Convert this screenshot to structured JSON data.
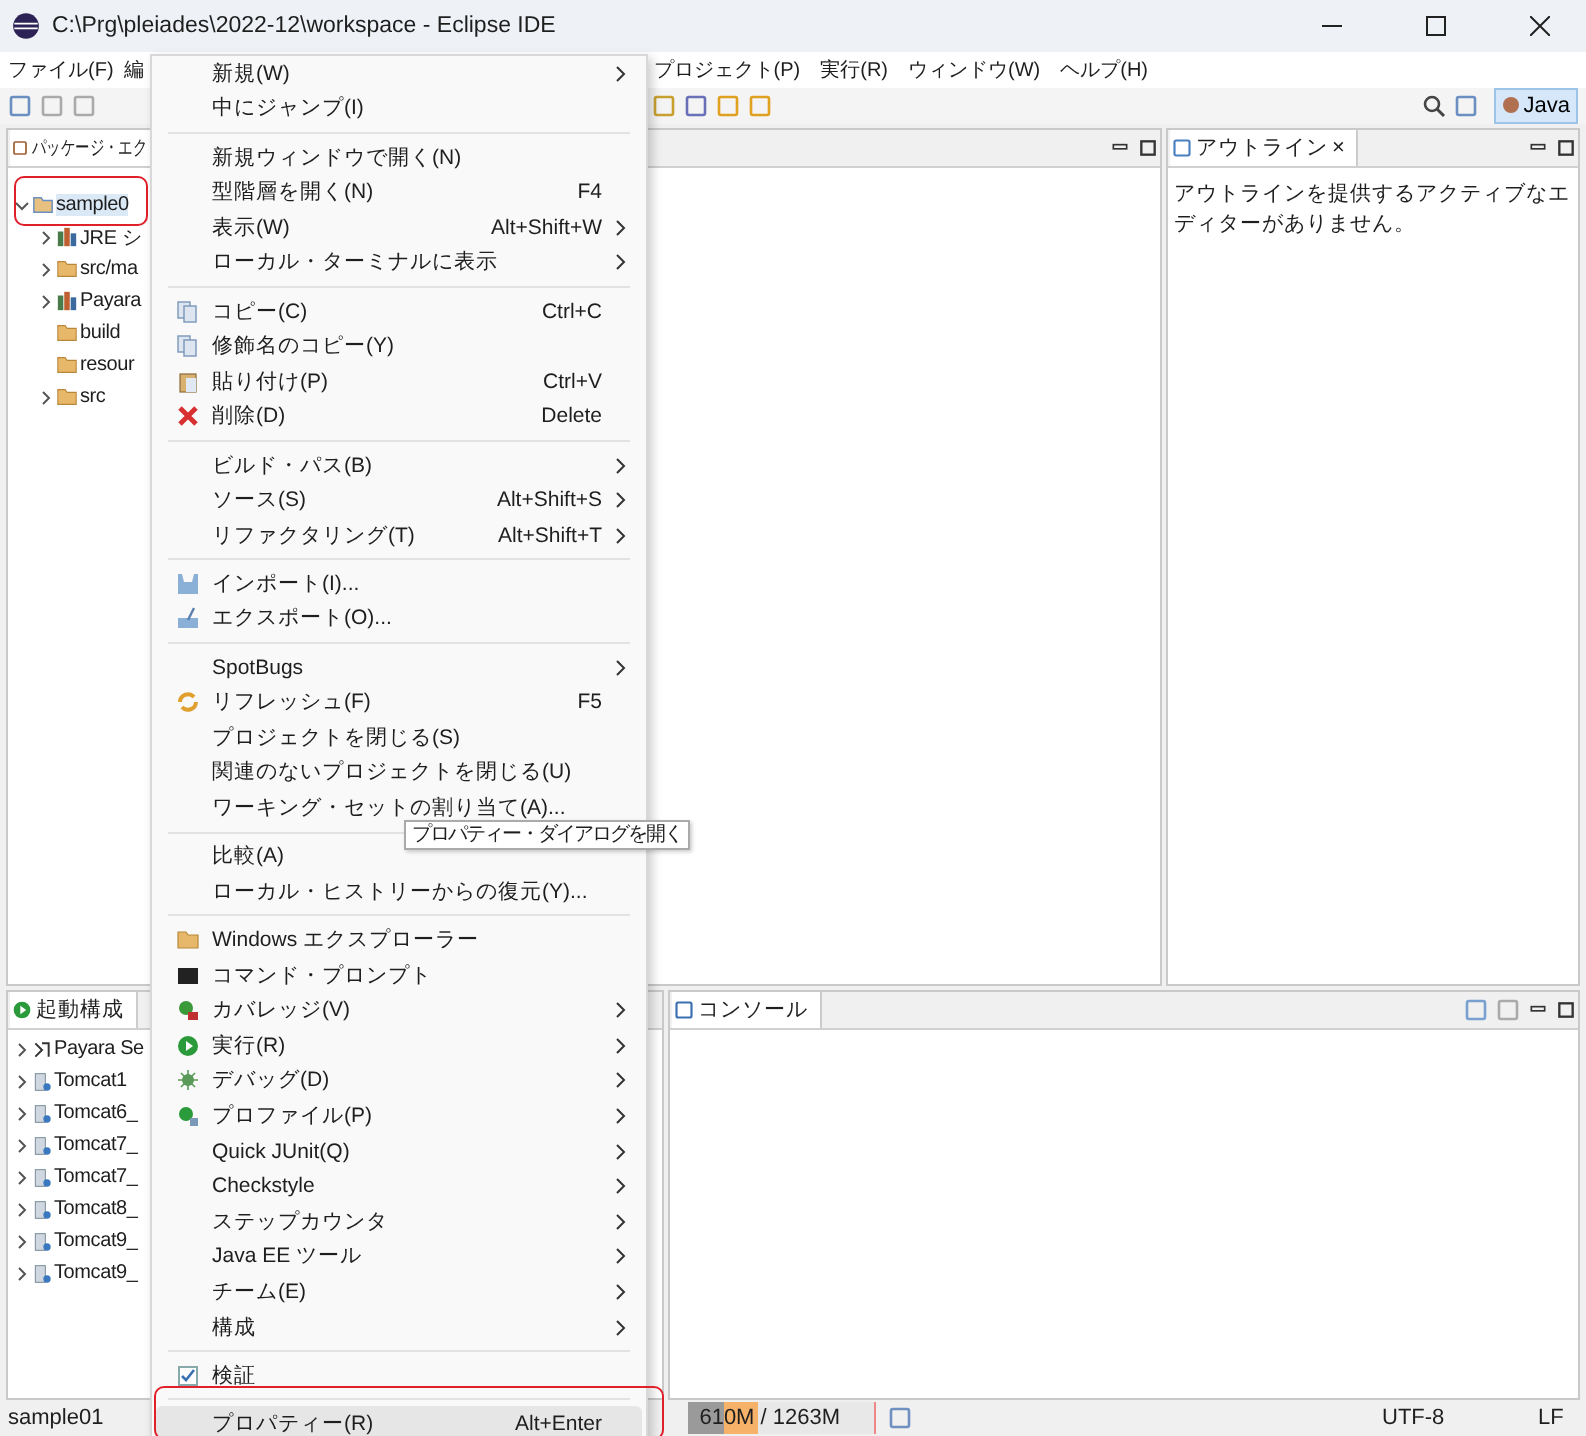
{
  "window": {
    "title": "C:\\Prg\\pleiades\\2022-12\\workspace - Eclipse IDE"
  },
  "menubar": {
    "left": [
      "ファイル(F)",
      "編"
    ],
    "right": [
      "プロジェクト(P)",
      "実行(R)",
      "ウィンドウ(W)",
      "ヘルプ(H)"
    ]
  },
  "toolbar": {
    "perspective": {
      "label": "Java",
      "selected": true
    }
  },
  "package_explorer": {
    "tab": "パッケージ・エク",
    "tree": [
      {
        "label": "sample0",
        "expanded": true,
        "selected": true,
        "annotated": true,
        "children": [
          {
            "label": "JRE シ",
            "expanded": false,
            "selected": false
          },
          {
            "label": "src/ma",
            "expanded": false,
            "selected": false
          },
          {
            "label": "Payara",
            "expanded": false,
            "selected": false
          },
          {
            "label": "build",
            "selected": false
          },
          {
            "label": "resour",
            "selected": false
          },
          {
            "label": "src",
            "expanded": false,
            "selected": false
          }
        ]
      }
    ]
  },
  "outline": {
    "tab": "アウトライン",
    "close": "×",
    "message": "アウトラインを提供するアクティブなエディターがありません。"
  },
  "launch_configs": {
    "tab": "起動構成",
    "items": [
      "Payara Se",
      "Tomcat1",
      "Tomcat6_",
      "Tomcat7_",
      "Tomcat7_",
      "Tomcat8_",
      "Tomcat9_",
      "Tomcat9_"
    ]
  },
  "console": {
    "tab": "コンソール"
  },
  "context_menu": {
    "groups": [
      [
        {
          "label": "新規(W)",
          "submenu": true,
          "selected": false
        },
        {
          "label": "中にジャンプ(I)",
          "submenu": false,
          "selected": false
        }
      ],
      [
        {
          "label": "新規ウィンドウで開く(N)",
          "submenu": false,
          "selected": false
        },
        {
          "label": "型階層を開く(N)",
          "shortcut": "F4",
          "submenu": false,
          "selected": false
        },
        {
          "label": "表示(W)",
          "shortcut": "Alt+Shift+W",
          "submenu": true,
          "selected": false
        },
        {
          "label": "ローカル・ターミナルに表示",
          "submenu": true,
          "selected": false
        }
      ],
      [
        {
          "label": "コピー(C)",
          "shortcut": "Ctrl+C",
          "submenu": false,
          "selected": false
        },
        {
          "label": "修飾名のコピー(Y)",
          "submenu": false,
          "selected": false
        },
        {
          "label": "貼り付け(P)",
          "shortcut": "Ctrl+V",
          "submenu": false,
          "selected": false
        },
        {
          "label": "削除(D)",
          "shortcut": "Delete",
          "submenu": false,
          "selected": false
        }
      ],
      [
        {
          "label": "ビルド・パス(B)",
          "submenu": true,
          "selected": false
        },
        {
          "label": "ソース(S)",
          "shortcut": "Alt+Shift+S",
          "submenu": true,
          "selected": false
        },
        {
          "label": "リファクタリング(T)",
          "shortcut": "Alt+Shift+T",
          "submenu": true,
          "selected": false
        }
      ],
      [
        {
          "label": "インポート(I)...",
          "submenu": false,
          "selected": false
        },
        {
          "label": "エクスポート(O)...",
          "submenu": false,
          "selected": false
        }
      ],
      [
        {
          "label": "SpotBugs",
          "submenu": true,
          "selected": false
        },
        {
          "label": "リフレッシュ(F)",
          "shortcut": "F5",
          "submenu": false,
          "selected": false
        },
        {
          "label": "プロジェクトを閉じる(S)",
          "submenu": false,
          "selected": false
        },
        {
          "label": "関連のないプロジェクトを閉じる(U)",
          "submenu": false,
          "selected": false
        },
        {
          "label": "ワーキング・セットの割り当て(A)...",
          "submenu": false,
          "selected": false
        }
      ],
      [
        {
          "label": "比較(A)",
          "submenu": false,
          "selected": false
        },
        {
          "label": "ローカル・ヒストリーからの復元(Y)...",
          "submenu": false,
          "selected": false
        }
      ],
      [
        {
          "label": "Windows エクスプローラー",
          "submenu": false,
          "selected": false
        },
        {
          "label": "コマンド・プロンプト",
          "submenu": false,
          "selected": false
        },
        {
          "label": "カバレッジ(V)",
          "submenu": true,
          "selected": false
        },
        {
          "label": "実行(R)",
          "submenu": true,
          "selected": false
        },
        {
          "label": "デバッグ(D)",
          "submenu": true,
          "selected": false
        },
        {
          "label": "プロファイル(P)",
          "submenu": true,
          "selected": false
        },
        {
          "label": "Quick JUnit(Q)",
          "submenu": true,
          "selected": false
        },
        {
          "label": "Checkstyle",
          "submenu": true,
          "selected": false
        },
        {
          "label": "ステップカウンタ",
          "submenu": true,
          "selected": false
        },
        {
          "label": "Java EE ツール",
          "submenu": true,
          "selected": false
        },
        {
          "label": "チーム(E)",
          "submenu": true,
          "selected": false
        },
        {
          "label": "構成",
          "submenu": true,
          "selected": false
        }
      ],
      [
        {
          "label": "検証",
          "checked": true,
          "submenu": false,
          "selected": false
        }
      ],
      [
        {
          "label": "プロパティー(R)",
          "shortcut": "Alt+Enter",
          "submenu": false,
          "selected": true,
          "annotated": true
        }
      ]
    ]
  },
  "tooltip": "プロパティー・ダイアログを開く",
  "status_bar": {
    "selection": "sample01",
    "memory": {
      "text": "610M / 1263M",
      "level": 0.38
    },
    "encoding": "UTF-8",
    "line_ending": "LF"
  }
}
